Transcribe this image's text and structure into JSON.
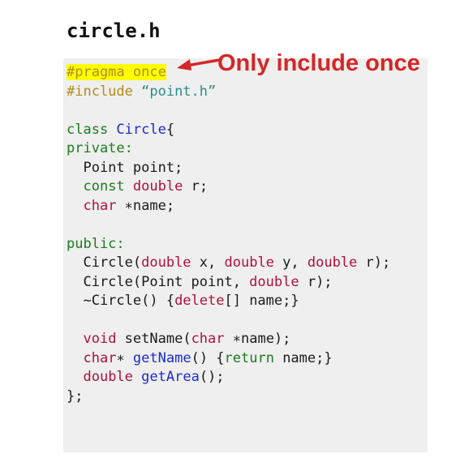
{
  "file": {
    "name": "circle.h"
  },
  "annotation": {
    "text": "Only include once",
    "color": "#d42727"
  },
  "colors": {
    "background": "#ffffff",
    "code_background": "#efefef",
    "highlight": "#ffff00",
    "preprocessor": "#b58a1b",
    "string": "#2e8b8b",
    "keyword": "#1f7a1f",
    "type": "#b0103a",
    "identifier": "#1a2ccc"
  },
  "code": {
    "lines": [
      [
        {
          "t": "#pragma once",
          "c": "pp hl"
        }
      ],
      [
        {
          "t": "#include ",
          "c": "pp"
        },
        {
          "t": "“point.h”",
          "c": "str"
        }
      ],
      [],
      [
        {
          "t": "class ",
          "c": "kw"
        },
        {
          "t": "Circle",
          "c": "cls"
        },
        {
          "t": "{",
          "c": ""
        }
      ],
      [
        {
          "t": "private:",
          "c": "kw"
        }
      ],
      [
        {
          "t": "  Point point;",
          "c": ""
        }
      ],
      [
        {
          "t": "  ",
          "c": ""
        },
        {
          "t": "const",
          "c": "kw"
        },
        {
          "t": " ",
          "c": ""
        },
        {
          "t": "double",
          "c": "ty"
        },
        {
          "t": " r;",
          "c": ""
        }
      ],
      [
        {
          "t": "  ",
          "c": ""
        },
        {
          "t": "char",
          "c": "ty"
        },
        {
          "t": " ∗name;",
          "c": ""
        }
      ],
      [],
      [
        {
          "t": "public:",
          "c": "kw"
        }
      ],
      [
        {
          "t": "  Circle(",
          "c": ""
        },
        {
          "t": "double",
          "c": "ty"
        },
        {
          "t": " x, ",
          "c": ""
        },
        {
          "t": "double",
          "c": "ty"
        },
        {
          "t": " y, ",
          "c": ""
        },
        {
          "t": "double",
          "c": "ty"
        },
        {
          "t": " r);",
          "c": ""
        }
      ],
      [
        {
          "t": "  Circle(Point point, ",
          "c": ""
        },
        {
          "t": "double",
          "c": "ty"
        },
        {
          "t": " r);",
          "c": ""
        }
      ],
      [
        {
          "t": "  ~Circle() {",
          "c": ""
        },
        {
          "t": "delete",
          "c": "ty"
        },
        {
          "t": "[] name;}",
          "c": ""
        }
      ],
      [],
      [
        {
          "t": "  ",
          "c": ""
        },
        {
          "t": "void",
          "c": "ty"
        },
        {
          "t": " setName(",
          "c": ""
        },
        {
          "t": "char",
          "c": "ty"
        },
        {
          "t": " ∗name);",
          "c": ""
        }
      ],
      [
        {
          "t": "  ",
          "c": ""
        },
        {
          "t": "char",
          "c": "ty"
        },
        {
          "t": "∗ ",
          "c": ""
        },
        {
          "t": "getName",
          "c": "fn"
        },
        {
          "t": "() {",
          "c": ""
        },
        {
          "t": "return",
          "c": "kw"
        },
        {
          "t": " name;}",
          "c": ""
        }
      ],
      [
        {
          "t": "  ",
          "c": ""
        },
        {
          "t": "double",
          "c": "ty"
        },
        {
          "t": " ",
          "c": ""
        },
        {
          "t": "getArea",
          "c": "fn"
        },
        {
          "t": "();",
          "c": ""
        }
      ],
      [
        {
          "t": "};",
          "c": ""
        }
      ]
    ]
  }
}
